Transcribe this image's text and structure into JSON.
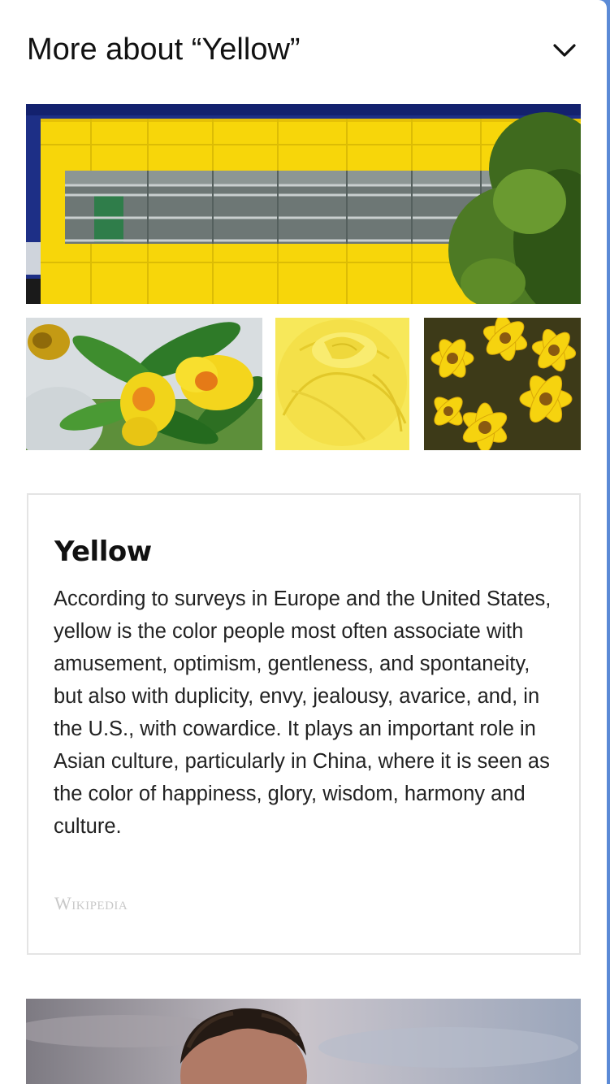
{
  "header": {
    "title": "More about “Yellow”",
    "toggle_icon": "chevron-down-icon"
  },
  "gallery": {
    "images": [
      {
        "name": "yellow-building-facade",
        "semantic": "image"
      },
      {
        "name": "yellow-hibiscus-flower",
        "semantic": "image"
      },
      {
        "name": "yellow-rose",
        "semantic": "image"
      },
      {
        "name": "yellow-daisies",
        "semantic": "image"
      }
    ]
  },
  "info_card": {
    "title": "Yellow",
    "description": "According to surveys in Europe and the United States, yellow is the color people most often associate with amusement, optimism, gentleness, and spontaneity, but also with duplicity, envy, jealousy, avarice, and, in the U.S., with cowardice. It plays an important role in Asian culture, particularly in China, where it is seen as the color of happiness, glory, wisdom, harmony and culture.",
    "source": "Wikipedia"
  },
  "colors": {
    "accent_yellow": "#f6d40c",
    "page_background": "#ffffff",
    "card_border": "#e4e4e4"
  }
}
